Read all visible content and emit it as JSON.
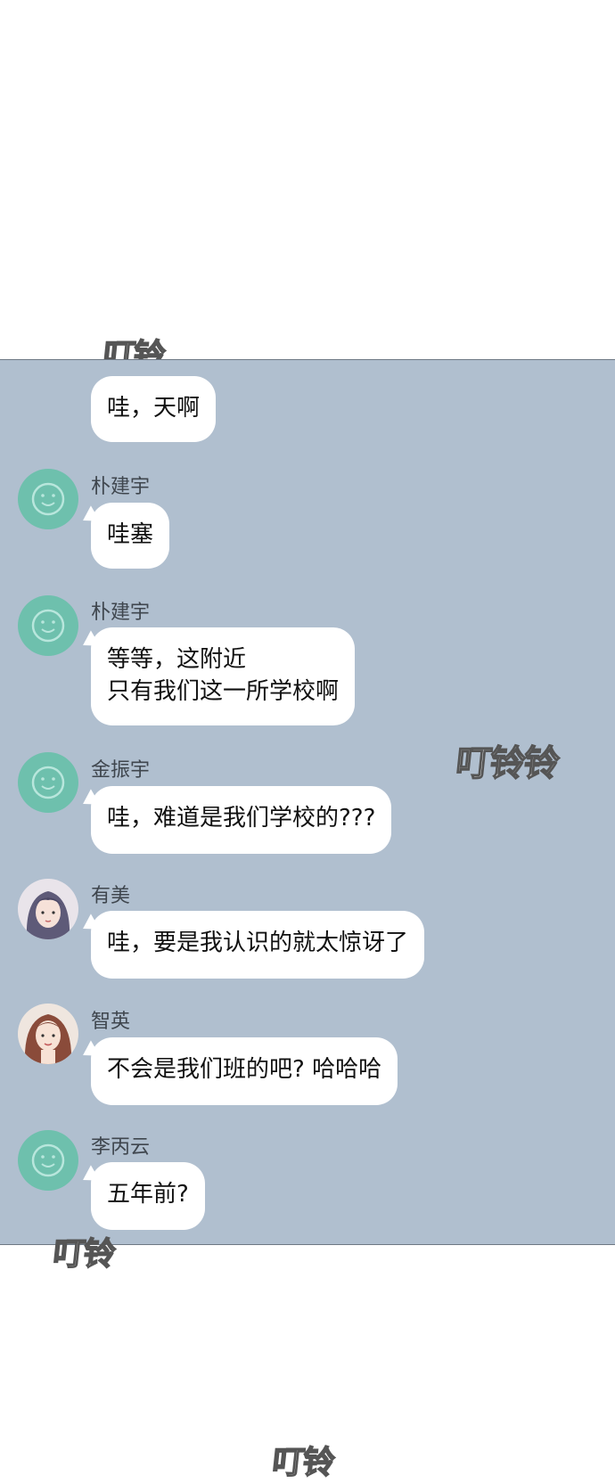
{
  "watermarks": [
    "叮铃",
    "叮铃铃",
    "叮铃",
    "叮铃"
  ],
  "messages": [
    {
      "sender": "",
      "lines": [
        "哇，天啊"
      ]
    },
    {
      "sender": "朴建宇",
      "avatar": "default-smiley-avatar",
      "lines": [
        "哇塞"
      ]
    },
    {
      "sender": "朴建宇",
      "avatar": "default-smiley-avatar",
      "lines": [
        "等等，这附近",
        "只有我们这一所学校啊"
      ]
    },
    {
      "sender": "金振宇",
      "avatar": "default-smiley-avatar",
      "lines": [
        "哇，难道是我们学校的???"
      ]
    },
    {
      "sender": "有美",
      "avatar": "girl-photo-avatar",
      "lines": [
        "哇，要是我认识的就太惊讶了"
      ]
    },
    {
      "sender": "智英",
      "avatar": "woman-photo-avatar",
      "lines": [
        "不会是我们班的吧? 哈哈哈"
      ]
    },
    {
      "sender": "李丙云",
      "avatar": "default-smiley-avatar",
      "lines": [
        "五年前?"
      ]
    }
  ],
  "colors": {
    "panel": "#b0bfcf",
    "bubble": "#ffffff",
    "default_avatar": "#6ec0ad"
  }
}
